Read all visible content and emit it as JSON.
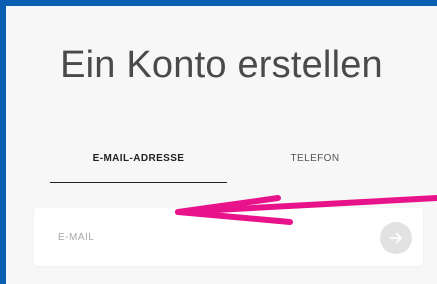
{
  "page": {
    "title": "Ein Konto erstellen"
  },
  "tabs": [
    {
      "label": "E-MAIL-ADRESSE",
      "active": true
    },
    {
      "label": "TELEFON",
      "active": false
    }
  ],
  "email_input": {
    "placeholder": "E-MAIL",
    "value": ""
  },
  "submit": {
    "icon": "arrow-right-icon"
  },
  "annotation": {
    "icon": "pointer-arrow-icon",
    "color": "#e8128a"
  },
  "colors": {
    "frame": "#0b5fb0",
    "background": "#f7f7f7",
    "button": "#e2e2e2"
  }
}
